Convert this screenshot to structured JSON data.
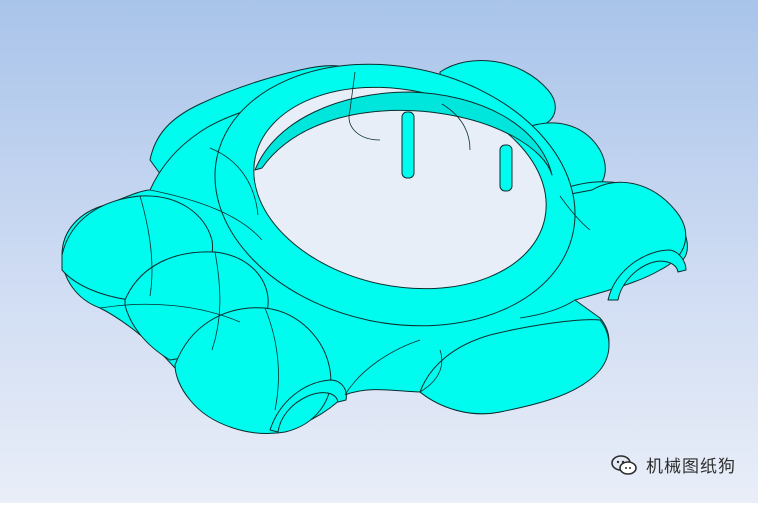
{
  "scene": {
    "subject": "watch-case",
    "model_color": "#00fbef",
    "edge_color": "#0a2e2e",
    "background_top": "#a9c4ea",
    "background_bottom": "#e9eef8"
  },
  "watermark": {
    "text": "机械图纸狗",
    "icon": "wechat-icon"
  }
}
